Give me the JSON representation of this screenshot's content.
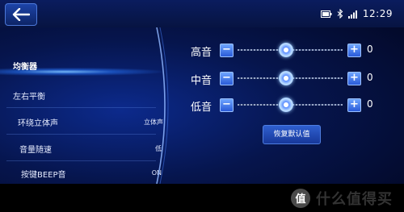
{
  "status_bar": {
    "time": "12:29",
    "icons": [
      "back-arrow-icon",
      "battery-icon",
      "bluetooth-icon",
      "signal-icon"
    ]
  },
  "menu": {
    "items": [
      {
        "label": "均衡器",
        "value": "",
        "active": true
      },
      {
        "label": "左右平衡",
        "value": ""
      },
      {
        "label": "环绕立体声",
        "value": "立体声"
      },
      {
        "label": "音量随速",
        "value": "低"
      },
      {
        "label": "按键BEEP音",
        "value": "ON"
      }
    ]
  },
  "equalizer": {
    "bands": [
      {
        "label": "高音",
        "value": "0",
        "level": 0.46
      },
      {
        "label": "中音",
        "value": "0",
        "level": 0.46
      },
      {
        "label": "低音",
        "value": "0",
        "level": 0.46
      }
    ],
    "minus_label": "−",
    "plus_label": "+",
    "reset_label": "恢复默认值"
  },
  "watermark": {
    "text": "什么值得买",
    "icon": "zhi-badge-icon"
  },
  "colors": {
    "accent": "#3f7bff",
    "background": "#06154d",
    "glow": "#78beff"
  }
}
